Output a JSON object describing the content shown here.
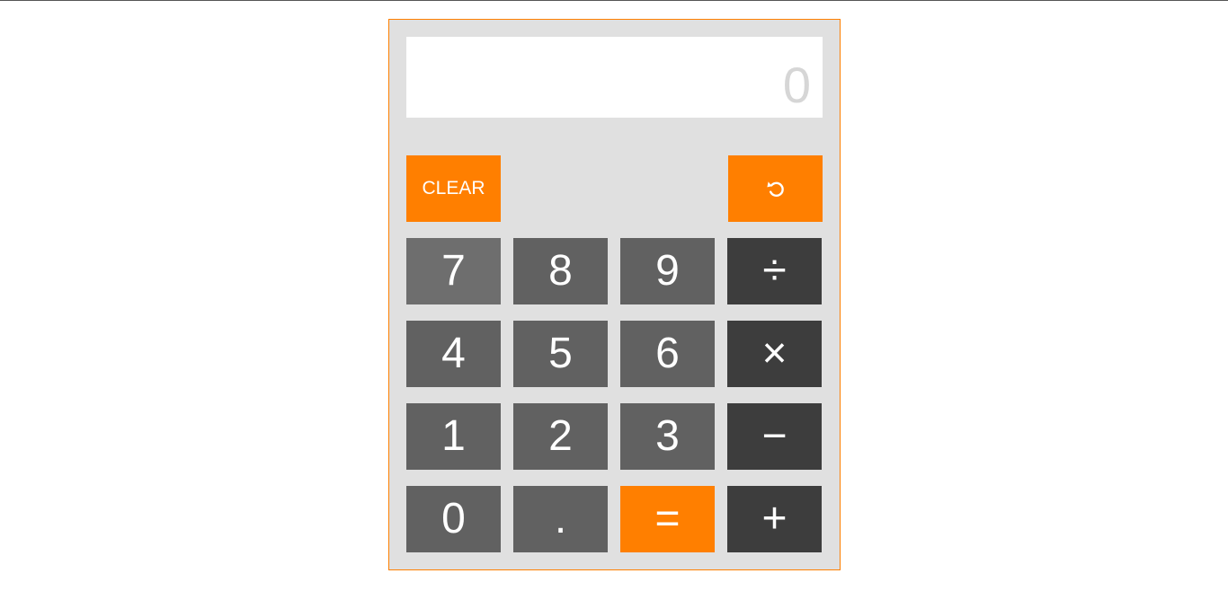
{
  "display": {
    "value": "0"
  },
  "controls": {
    "clear_label": "CLEAR",
    "undo_icon": "undo-icon"
  },
  "keys": {
    "k7": "7",
    "k8": "8",
    "k9": "9",
    "divide": "÷",
    "k4": "4",
    "k5": "5",
    "k6": "6",
    "multiply": "×",
    "k1": "1",
    "k2": "2",
    "k3": "3",
    "subtract": "−",
    "k0": "0",
    "decimal": ".",
    "equals": "=",
    "add": "+"
  },
  "colors": {
    "accent": "#ff7f00",
    "number_key": "#616161",
    "operator_key": "#3d3d3d",
    "panel": "#e0e0e0",
    "display_text": "#d6d6d6"
  }
}
